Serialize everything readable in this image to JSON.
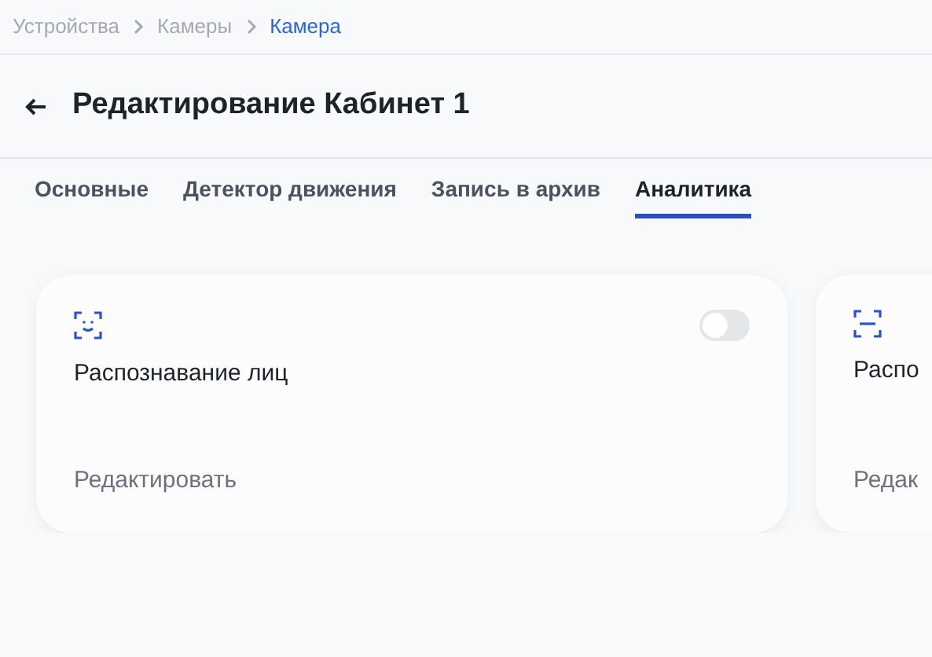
{
  "breadcrumbs": [
    {
      "label": "Устройства",
      "current": false
    },
    {
      "label": "Камеры",
      "current": false
    },
    {
      "label": "Камера",
      "current": true
    }
  ],
  "page_title": "Редактирование Кабинет 1",
  "tabs": [
    {
      "label": "Основные",
      "selected": false
    },
    {
      "label": "Детектор движения",
      "selected": false
    },
    {
      "label": "Запись в архив",
      "selected": false
    },
    {
      "label": "Аналитика",
      "selected": true
    }
  ],
  "cards": [
    {
      "kind": "face",
      "title": "Распознавание лиц",
      "on": false,
      "action": "Редактировать"
    },
    {
      "kind": "line",
      "title": "Распо",
      "action": "Редак"
    }
  ]
}
